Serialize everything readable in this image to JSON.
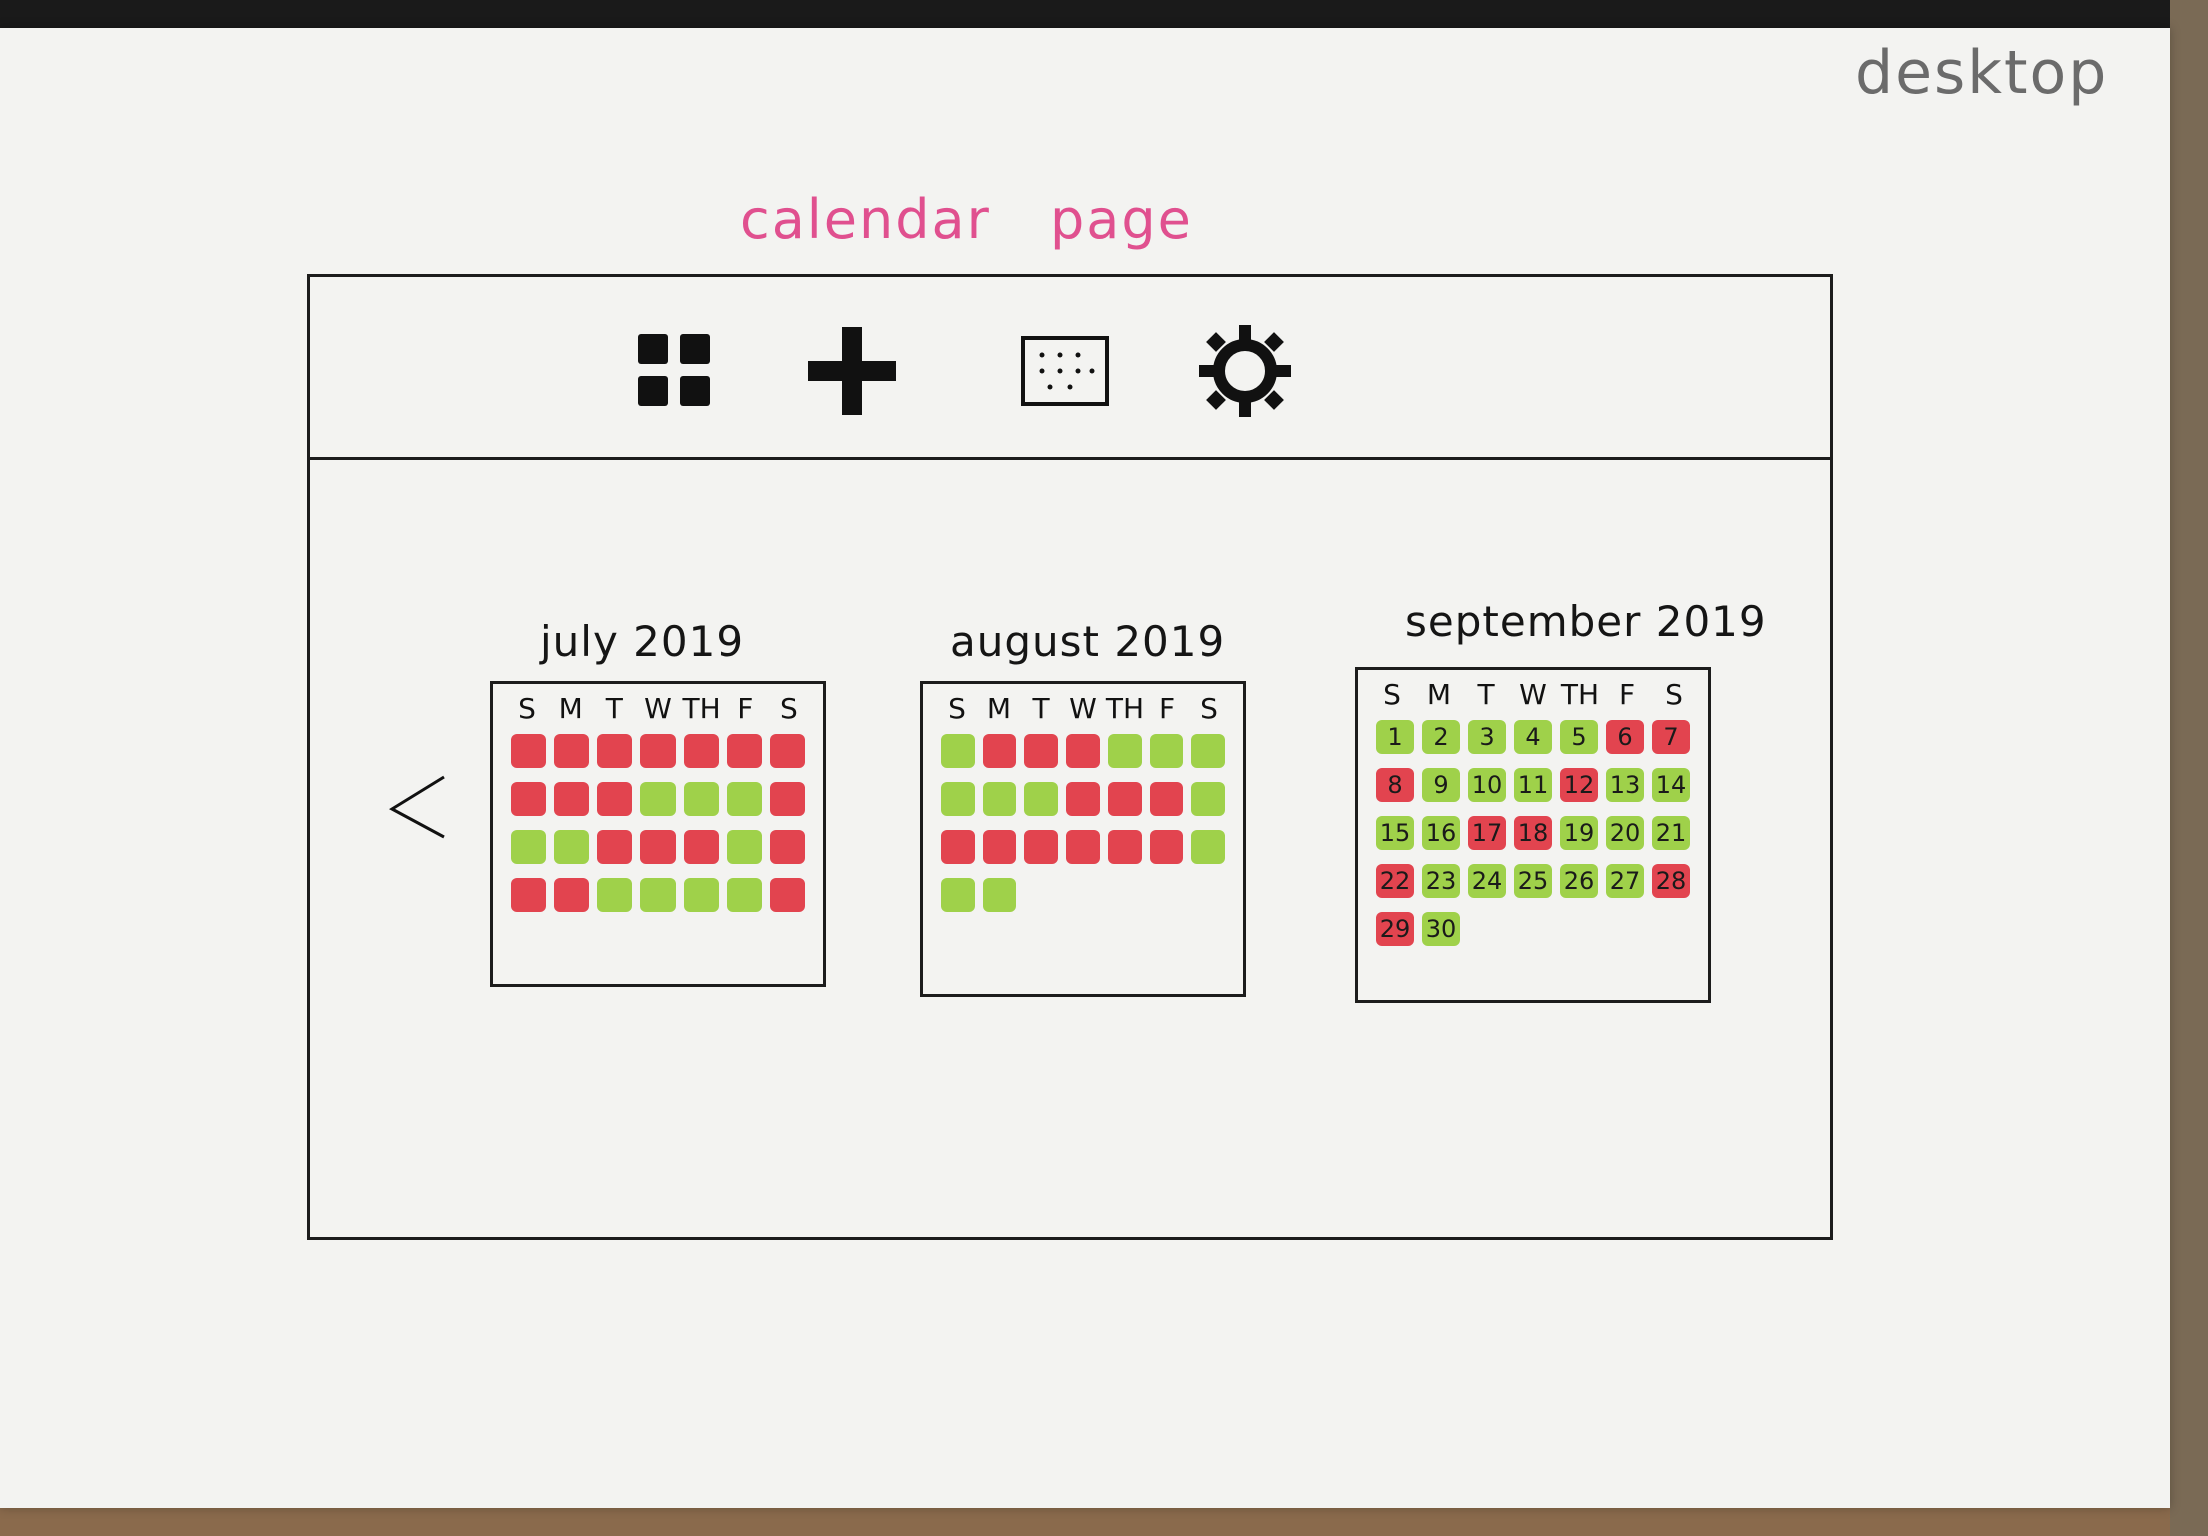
{
  "corner_label": "desktop",
  "page_heading": "calendar page",
  "toolbar": {
    "items": [
      {
        "id": "grid",
        "icon": "grid-icon"
      },
      {
        "id": "add",
        "icon": "plus-icon"
      },
      {
        "id": "calendar",
        "icon": "calendar-icon"
      },
      {
        "id": "settings",
        "icon": "gear-icon"
      }
    ]
  },
  "nav": {
    "prev_icon": "chevron-left-icon"
  },
  "weekday_headers": [
    "S",
    "M",
    "T",
    "W",
    "TH",
    "F",
    "S"
  ],
  "status_colors": {
    "busy": "#e2444f",
    "free": "#9fd14a"
  },
  "months": [
    {
      "title": "july 2019",
      "numbered": false,
      "days": [
        "r",
        "r",
        "r",
        "r",
        "r",
        "r",
        "r",
        "r",
        "r",
        "r",
        "g",
        "g",
        "g",
        "r",
        "g",
        "g",
        "r",
        "r",
        "r",
        "g",
        "r",
        "r",
        "r",
        "g",
        "g",
        "g",
        "g",
        "r"
      ]
    },
    {
      "title": "august 2019",
      "numbered": false,
      "days": [
        "g",
        "r",
        "r",
        "r",
        "g",
        "g",
        "g",
        "g",
        "g",
        "g",
        "r",
        "r",
        "r",
        "g",
        "r",
        "r",
        "r",
        "r",
        "r",
        "r",
        "g",
        "g",
        "g",
        "-",
        "-",
        "-",
        "-",
        "-"
      ]
    },
    {
      "title": "september 2019",
      "numbered": true,
      "days": [
        {
          "n": "1",
          "s": "g"
        },
        {
          "n": "2",
          "s": "g"
        },
        {
          "n": "3",
          "s": "g"
        },
        {
          "n": "4",
          "s": "g"
        },
        {
          "n": "5",
          "s": "g"
        },
        {
          "n": "6",
          "s": "r"
        },
        {
          "n": "7",
          "s": "r"
        },
        {
          "n": "8",
          "s": "r"
        },
        {
          "n": "9",
          "s": "g"
        },
        {
          "n": "10",
          "s": "g"
        },
        {
          "n": "11",
          "s": "g"
        },
        {
          "n": "12",
          "s": "r"
        },
        {
          "n": "13",
          "s": "g"
        },
        {
          "n": "14",
          "s": "g"
        },
        {
          "n": "15",
          "s": "g"
        },
        {
          "n": "16",
          "s": "g"
        },
        {
          "n": "17",
          "s": "r"
        },
        {
          "n": "18",
          "s": "r"
        },
        {
          "n": "19",
          "s": "g"
        },
        {
          "n": "20",
          "s": "g"
        },
        {
          "n": "21",
          "s": "g"
        },
        {
          "n": "22",
          "s": "r"
        },
        {
          "n": "23",
          "s": "g"
        },
        {
          "n": "24",
          "s": "g"
        },
        {
          "n": "25",
          "s": "g"
        },
        {
          "n": "26",
          "s": "g"
        },
        {
          "n": "27",
          "s": "g"
        },
        {
          "n": "28",
          "s": "r"
        },
        {
          "n": "29",
          "s": "r"
        },
        {
          "n": "30",
          "s": "g"
        },
        {
          "n": "",
          "s": "-"
        },
        {
          "n": "",
          "s": "-"
        },
        {
          "n": "",
          "s": "-"
        },
        {
          "n": "",
          "s": "-"
        },
        {
          "n": "",
          "s": "-"
        }
      ]
    }
  ]
}
